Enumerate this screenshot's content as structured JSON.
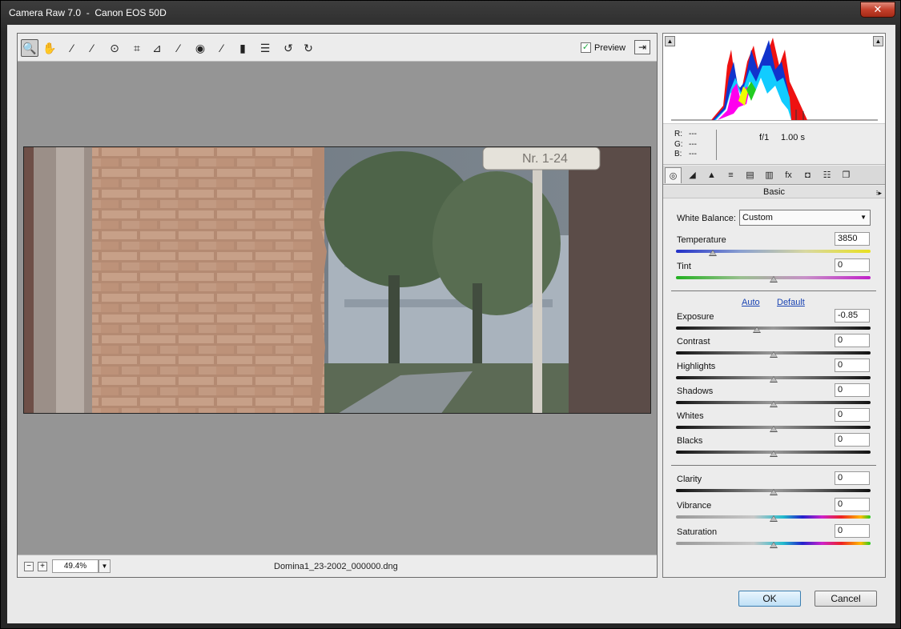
{
  "window": {
    "title": "Camera Raw 7.0  -  Canon EOS 50D",
    "close_glyph": "✕"
  },
  "toolbar": {
    "tools": [
      {
        "name": "zoom-tool",
        "glyph": "🔍",
        "active": true
      },
      {
        "name": "hand-tool",
        "glyph": "✋"
      },
      {
        "name": "white-balance-tool",
        "glyph": "⁄"
      },
      {
        "name": "color-sampler-tool",
        "glyph": "⁄"
      },
      {
        "name": "targeted-adjustment-tool",
        "glyph": "⊙"
      },
      {
        "name": "crop-tool",
        "glyph": "⌗"
      },
      {
        "name": "straighten-tool",
        "glyph": "⊿"
      },
      {
        "name": "spot-removal-tool",
        "glyph": "⁄"
      },
      {
        "name": "red-eye-removal-tool",
        "glyph": "◉"
      },
      {
        "name": "adjustment-brush-tool",
        "glyph": "⁄"
      },
      {
        "name": "graduated-filter-tool",
        "glyph": "▮"
      },
      {
        "name": "preferences-icon",
        "glyph": "☰"
      },
      {
        "name": "rotate-ccw-icon",
        "glyph": "↺"
      },
      {
        "name": "rotate-cw-icon",
        "glyph": "↻"
      }
    ],
    "preview_label": "Preview",
    "preview_checked": true,
    "fullscreen_glyph": "⇥"
  },
  "bottombar": {
    "zoom_out_glyph": "−",
    "zoom_in_glyph": "+",
    "zoom_value": "49.4%",
    "zoom_arrow": "▼",
    "filename": "Domina1_23-2002_000000.dng"
  },
  "readout": {
    "r_label": "R:",
    "r_value": "---",
    "g_label": "G:",
    "g_value": "---",
    "b_label": "B:",
    "b_value": "---",
    "aperture": "f/1",
    "shutter": "1.00 s"
  },
  "panel": {
    "tabs": [
      {
        "name": "tab-basic",
        "glyph": "◎",
        "active": true
      },
      {
        "name": "tab-tone-curve",
        "glyph": "◢"
      },
      {
        "name": "tab-detail",
        "glyph": "▲"
      },
      {
        "name": "tab-hsl",
        "glyph": "≡"
      },
      {
        "name": "tab-split-toning",
        "glyph": "▤"
      },
      {
        "name": "tab-lens-corrections",
        "glyph": "▥"
      },
      {
        "name": "tab-effects",
        "glyph": "fx"
      },
      {
        "name": "tab-camera-calibration",
        "glyph": "◘"
      },
      {
        "name": "tab-presets",
        "glyph": "☷"
      },
      {
        "name": "tab-snapshots",
        "glyph": "❐"
      }
    ],
    "heading": "Basic",
    "menu_glyph": "⁝▸",
    "white_balance_label": "White Balance:",
    "white_balance_value": "Custom",
    "auto_label": "Auto",
    "default_label": "Default"
  },
  "sliders": [
    {
      "id": "temperature",
      "label": "Temperature",
      "value": "3850",
      "level": 0.19,
      "track": "temp"
    },
    {
      "id": "tint",
      "label": "Tint",
      "value": "0",
      "level": 0.5,
      "track": "tint"
    },
    {
      "id": "exposure",
      "label": "Exposure",
      "value": "-0.85",
      "level": 0.415,
      "track": "gray"
    },
    {
      "id": "contrast",
      "label": "Contrast",
      "value": "0",
      "level": 0.5,
      "track": "gray"
    },
    {
      "id": "highlights",
      "label": "Highlights",
      "value": "0",
      "level": 0.5,
      "track": "gray"
    },
    {
      "id": "shadows",
      "label": "Shadows",
      "value": "0",
      "level": 0.5,
      "track": "gray"
    },
    {
      "id": "whites",
      "label": "Whites",
      "value": "0",
      "level": 0.5,
      "track": "gray"
    },
    {
      "id": "blacks",
      "label": "Blacks",
      "value": "0",
      "level": 0.5,
      "track": "gray"
    },
    {
      "id": "clarity",
      "label": "Clarity",
      "value": "0",
      "level": 0.5,
      "track": "gray"
    },
    {
      "id": "vibrance",
      "label": "Vibrance",
      "value": "0",
      "level": 0.5,
      "track": "rainbow"
    },
    {
      "id": "saturation",
      "label": "Saturation",
      "value": "0",
      "level": 0.5,
      "track": "rainbow"
    }
  ],
  "buttons": {
    "ok": "OK",
    "cancel": "Cancel"
  },
  "colors": {
    "preview_bg": "#959595",
    "link": "#1a44b3",
    "ok_border": "#3c7fb1"
  }
}
